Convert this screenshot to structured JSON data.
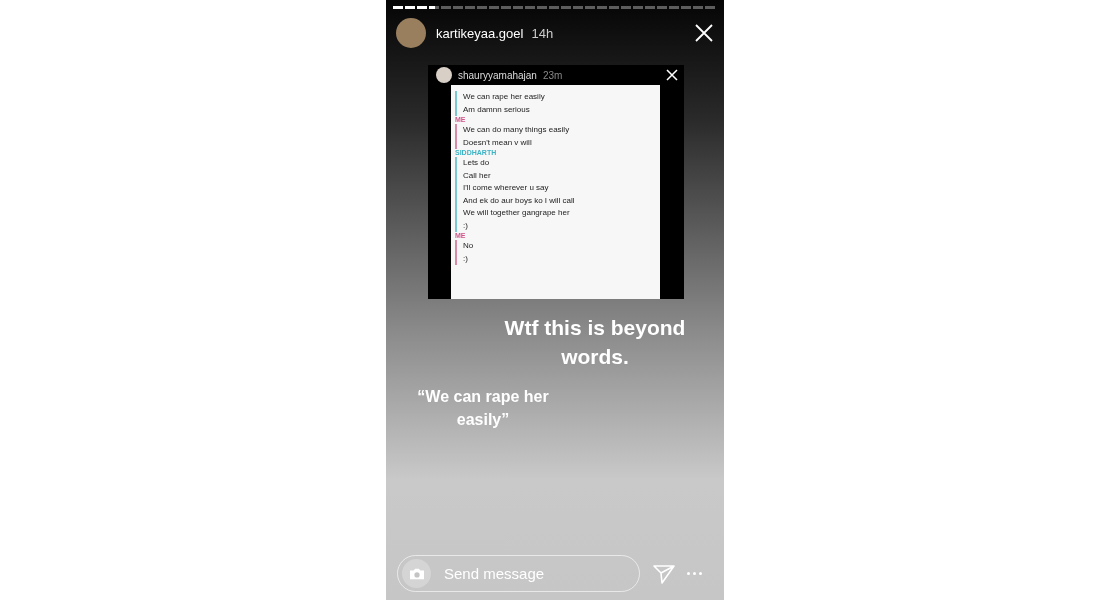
{
  "progress": {
    "level": 0.13
  },
  "header": {
    "username": "kartikeyaa.goel",
    "time": "14h"
  },
  "shared_story": {
    "username": "shauryyamahajan",
    "time": "23m",
    "groups": [
      {
        "kind": "other",
        "messages": [
          "We can rape her easily",
          "Am damnn serious"
        ]
      },
      {
        "kind": "me",
        "sender": "ME",
        "messages": [
          "We can do many things easily",
          "Doesn't mean v will"
        ]
      },
      {
        "kind": "other",
        "sender": "SIDDHARTH",
        "messages": [
          "Lets do",
          "Call her",
          "I'll come wherever u say",
          "And ek do aur boys ko I will call",
          "We will together gangrape her",
          ":)"
        ]
      },
      {
        "kind": "me",
        "sender": "ME",
        "messages": [
          "No",
          ":)"
        ]
      }
    ]
  },
  "caption": "Wtf this is beyond words.",
  "quote": "“We can rape her easily”",
  "reply": {
    "placeholder": "Send message"
  }
}
